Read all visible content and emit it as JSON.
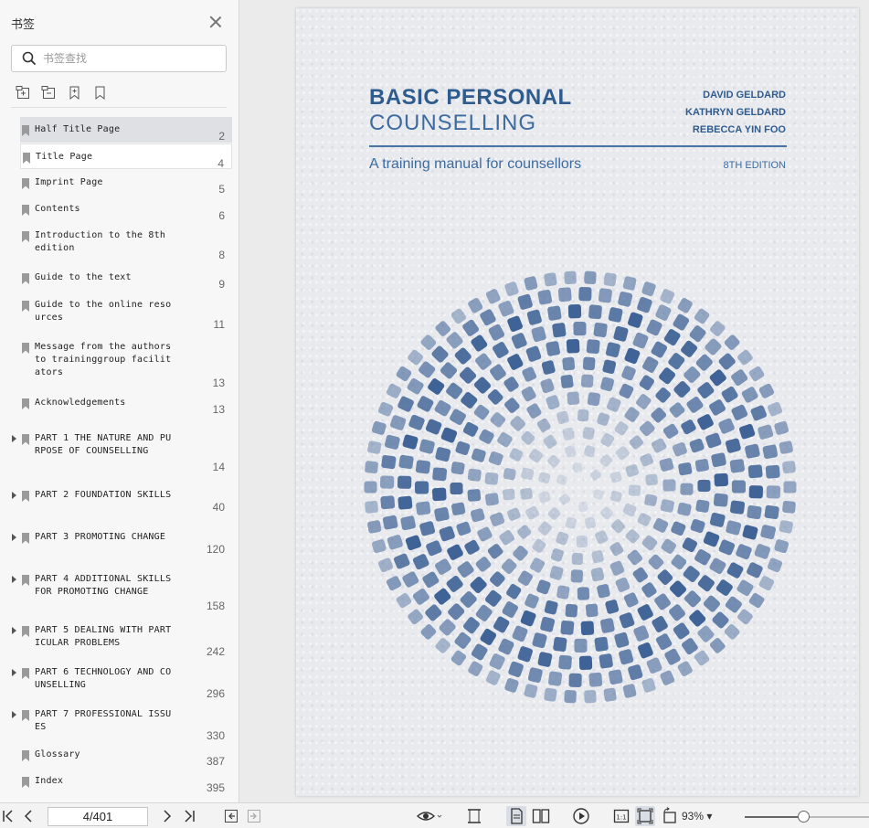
{
  "sidebar": {
    "title": "书签",
    "search_placeholder": "书签查找",
    "bookmarks": [
      {
        "label": "Half Title Page",
        "page": "2",
        "expandable": false
      },
      {
        "label": "Title Page",
        "page": "4",
        "expandable": false
      },
      {
        "label": "Imprint Page",
        "page": "5",
        "expandable": false
      },
      {
        "label": "Contents",
        "page": "6",
        "expandable": false
      },
      {
        "label": "Introduction to the 8th edition",
        "page": "8",
        "expandable": false
      },
      {
        "label": "Guide to the text",
        "page": "9",
        "expandable": false
      },
      {
        "label": "Guide to the online resources",
        "page": "11",
        "expandable": false
      },
      {
        "label": "Message from the authors to traininggroup facilitators",
        "page": "13",
        "expandable": false
      },
      {
        "label": "Acknowledgements",
        "page": "13",
        "expandable": false
      },
      {
        "label": "PART 1 THE NATURE AND PURPOSE OF COUNSELLING",
        "page": "14",
        "expandable": true
      },
      {
        "label": "PART 2 FOUNDATION SKILLS",
        "page": "40",
        "expandable": true
      },
      {
        "label": "PART 3 PROMOTING CHANGE",
        "page": "120",
        "expandable": true
      },
      {
        "label": "PART 4 ADDITIONAL SKILLS FOR PROMOTING CHANGE",
        "page": "158",
        "expandable": true
      },
      {
        "label": "PART 5 DEALING WITH PARTICULAR PROBLEMS",
        "page": "242",
        "expandable": true
      },
      {
        "label": "PART 6 TECHNOLOGY AND COUNSELLING",
        "page": "296",
        "expandable": true
      },
      {
        "label": "PART 7 PROFESSIONAL ISSUES",
        "page": "330",
        "expandable": true
      },
      {
        "label": "Glossary",
        "page": "387",
        "expandable": false
      },
      {
        "label": "Index",
        "page": "395",
        "expandable": false
      }
    ]
  },
  "cover": {
    "title_line1": "BASIC PERSONAL",
    "title_line2": "COUNSELLING",
    "authors": [
      "DAVID GELDARD",
      "KATHRYN GELDARD",
      "REBECCA YIN FOO"
    ],
    "subtitle": "A training manual for counsellors",
    "edition": "8TH EDITION",
    "accent_color": "#2f5c8f"
  },
  "toolbar": {
    "page_indicator": "4/401",
    "zoom": "93%",
    "zoom_fraction": 0.47
  },
  "icons": [
    "close-icon",
    "search-icon",
    "add-bookmark-icon",
    "remove-bookmark-icon",
    "bookmark-icon",
    "bookmark-outline-icon",
    "bookmark-flag-icon",
    "expand-arrow-icon",
    "first-page-icon",
    "prev-page-icon",
    "next-page-icon",
    "last-page-icon",
    "back-icon",
    "forward-icon",
    "eye-mode-icon",
    "fit-width-icon",
    "single-page-icon",
    "double-page-icon",
    "play-icon",
    "actual-size-icon",
    "fit-page-icon",
    "rotate-icon"
  ]
}
